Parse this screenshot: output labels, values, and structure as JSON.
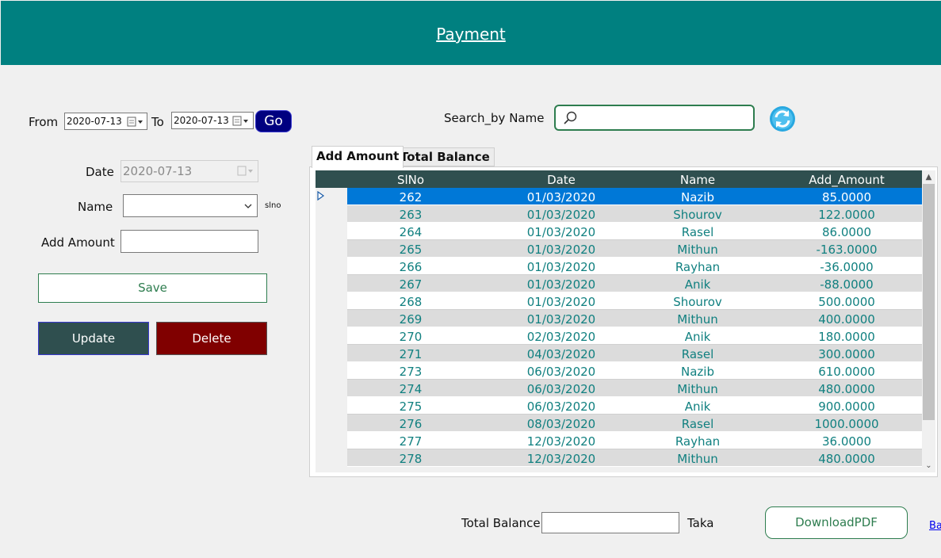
{
  "header": {
    "title": "Payment"
  },
  "filter": {
    "from_label": "From",
    "from_value": "2020-07-13",
    "to_label": "To",
    "to_value": "2020-07-13",
    "go_label": "Go"
  },
  "form": {
    "date_label": "Date",
    "date_value": "2020-07-13",
    "name_label": "Name",
    "name_value": "",
    "slno_label": "slno",
    "add_amount_label": "Add Amount",
    "add_amount_value": "",
    "save_label": "Save",
    "update_label": "Update",
    "delete_label": "Delete"
  },
  "search": {
    "label": "Search_by Name",
    "value": ""
  },
  "tabs": [
    {
      "label": "Add Amount",
      "active": true
    },
    {
      "label": "Total Balance",
      "active": false
    }
  ],
  "grid": {
    "columns": [
      "SlNo",
      "Date",
      "Name",
      "Add_Amount"
    ],
    "rows": [
      [
        "262",
        "01/03/2020",
        "Nazib",
        "85.0000"
      ],
      [
        "263",
        "01/03/2020",
        "Shourov",
        "122.0000"
      ],
      [
        "264",
        "01/03/2020",
        "Rasel",
        "86.0000"
      ],
      [
        "265",
        "01/03/2020",
        "Mithun",
        "-163.0000"
      ],
      [
        "266",
        "01/03/2020",
        "Rayhan",
        "-36.0000"
      ],
      [
        "267",
        "01/03/2020",
        "Anik",
        "-88.0000"
      ],
      [
        "268",
        "01/03/2020",
        "Shourov",
        "500.0000"
      ],
      [
        "269",
        "01/03/2020",
        "Mithun",
        "400.0000"
      ],
      [
        "270",
        "02/03/2020",
        "Anik",
        "180.0000"
      ],
      [
        "271",
        "04/03/2020",
        "Rasel",
        "300.0000"
      ],
      [
        "273",
        "06/03/2020",
        "Nazib",
        "610.0000"
      ],
      [
        "274",
        "06/03/2020",
        "Mithun",
        "480.0000"
      ],
      [
        "275",
        "06/03/2020",
        "Anik",
        "900.0000"
      ],
      [
        "276",
        "08/03/2020",
        "Rasel",
        "1000.0000"
      ],
      [
        "277",
        "12/03/2020",
        "Rayhan",
        "36.0000"
      ],
      [
        "278",
        "12/03/2020",
        "Mithun",
        "480.0000"
      ]
    ]
  },
  "footer": {
    "total_balance_label": "Total Balance",
    "total_balance_value": "",
    "currency_label": "Taka",
    "download_label": "DownloadPDF",
    "back_label": "Ba"
  },
  "colors": {
    "header": "#008080",
    "grid_header": "#2f4f4f",
    "selected_row": "#0078d7",
    "update_button": "#2f4f4f",
    "delete_button": "#800000",
    "go_button": "#000080",
    "accent_green": "#2e7d4f"
  }
}
